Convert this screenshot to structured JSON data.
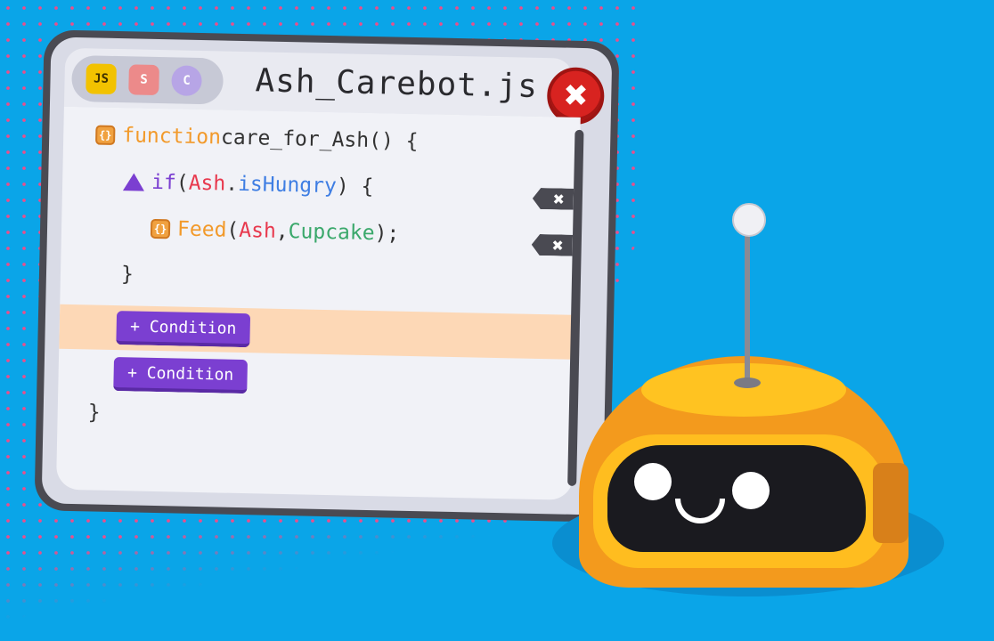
{
  "window": {
    "title": "Ash_Carebot.js",
    "language_tabs": [
      {
        "label": "JS",
        "icon": "javascript-icon"
      },
      {
        "label": "S",
        "icon": "swift-icon"
      },
      {
        "label": "C",
        "icon": "csharp-icon"
      }
    ],
    "close_symbol": "✖"
  },
  "code": {
    "fn_keyword": "function",
    "fn_name": " care_for_Ash() {",
    "if_keyword": "if",
    "if_open": " (",
    "if_obj": "Ash",
    "if_dot": ".",
    "if_prop": "isHungry",
    "if_close": ") {",
    "call_name": "Feed",
    "call_open": "(",
    "call_arg1": "Ash",
    "call_comma": ",",
    "call_arg2": "Cupcake",
    "call_close": ");",
    "inner_close": "}",
    "outer_close": "}",
    "delete_symbol": "✖",
    "condition_buttons": [
      "+ Condition",
      "+ Condition"
    ]
  },
  "colors": {
    "background": "#0aa5e8",
    "keyword": "#f29a2b",
    "if_keyword": "#7b3fd1",
    "object": "#e8394e",
    "property": "#3f7ee3",
    "argument": "#3aa86b",
    "highlight": "#fdd8b6",
    "robot_body": "#f39a1d"
  }
}
